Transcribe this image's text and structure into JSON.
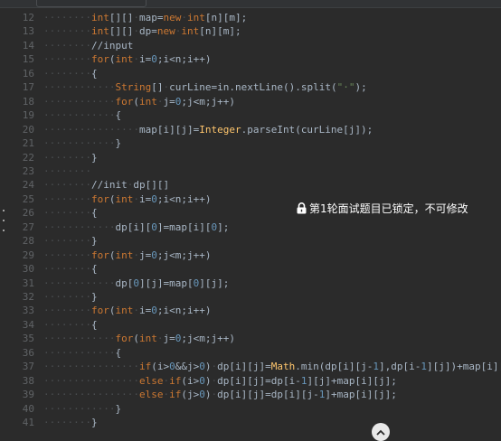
{
  "editor": {
    "lines": [
      {
        "n": "12",
        "code": "········int[][]·map=new·int[n][m];"
      },
      {
        "n": "13",
        "code": "········int[][]·dp=new·int[n][m];"
      },
      {
        "n": "14",
        "code": "········//input"
      },
      {
        "n": "15",
        "code": "········for(int·i=0;i<n;i++)"
      },
      {
        "n": "16",
        "code": "········{"
      },
      {
        "n": "17",
        "code": "············String[]·curLine=in.nextLine().split(\"·\");"
      },
      {
        "n": "18",
        "code": "············for(int·j=0;j<m;j++)"
      },
      {
        "n": "19",
        "code": "············{"
      },
      {
        "n": "20",
        "code": "················map[i][j]=Integer.parseInt(curLine[j]);"
      },
      {
        "n": "21",
        "code": "············}"
      },
      {
        "n": "22",
        "code": "········}"
      },
      {
        "n": "23",
        "code": "········"
      },
      {
        "n": "24",
        "code": "········//init·dp[][]"
      },
      {
        "n": "25",
        "code": "········for(int·i=0;i<n;i++)"
      },
      {
        "n": "26",
        "code": "········{"
      },
      {
        "n": "27",
        "code": "············dp[i][0]=map[i][0];"
      },
      {
        "n": "28",
        "code": "········}"
      },
      {
        "n": "29",
        "code": "········for(int·j=0;j<m;j++)"
      },
      {
        "n": "30",
        "code": "········{"
      },
      {
        "n": "31",
        "code": "············dp[0][j]=map[0][j];"
      },
      {
        "n": "32",
        "code": "········}"
      },
      {
        "n": "33",
        "code": "········for(int·i=0;i<n;i++)"
      },
      {
        "n": "34",
        "code": "········{"
      },
      {
        "n": "35",
        "code": "············for(int·j=0;j<m;j++)"
      },
      {
        "n": "36",
        "code": "············{"
      },
      {
        "n": "37",
        "code": "················if(i>0&&j>0)·dp[i][j]=Math.min(dp[i][j-1],dp[i-1][j])+map[i][j];"
      },
      {
        "n": "38",
        "code": "················else·if(i>0)·dp[i][j]=dp[i-1][j]+map[i][j];"
      },
      {
        "n": "39",
        "code": "················else·if(j>0)·dp[i][j]=dp[i][j-1]+map[i][j];"
      },
      {
        "n": "40",
        "code": "············}"
      },
      {
        "n": "41",
        "code": "········}"
      }
    ]
  },
  "notice": {
    "text": "第1轮面试题目已锁定，不可修改",
    "icon": "lock-icon"
  },
  "scroll_button": {
    "icon": "chevron-up-icon"
  },
  "colors": {
    "background": "#2b2b2b",
    "keyword": "#cc7832",
    "number": "#6897bb",
    "string": "#6a8759",
    "comment": "#7a7e85",
    "text": "#a9b7c6",
    "line_number": "#606366"
  }
}
